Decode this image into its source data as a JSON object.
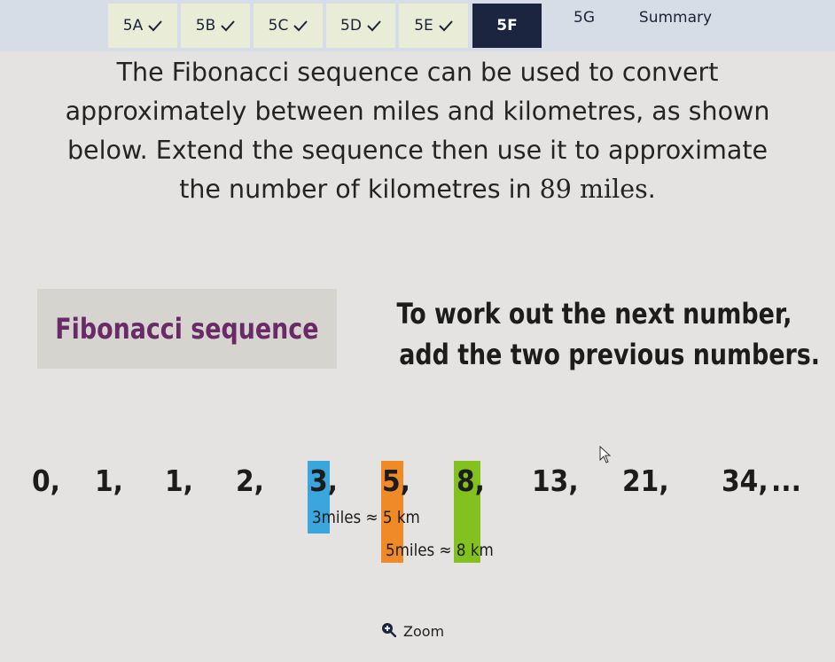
{
  "tabs": [
    {
      "label": "5A",
      "done": true
    },
    {
      "label": "5B",
      "done": true
    },
    {
      "label": "5C",
      "done": true
    },
    {
      "label": "5D",
      "done": true
    },
    {
      "label": "5E",
      "done": true
    },
    {
      "label": "5F",
      "active": true
    },
    {
      "label": "5G"
    },
    {
      "label": "Summary"
    }
  ],
  "question": {
    "line1": "The Fibonacci sequence can be used to convert",
    "line2": "approximately between miles and kilometres, as shown",
    "line3_before": "below. Extend the sequence then use it to approximate",
    "line4_before": "the number of kilometres in ",
    "line4_math": "89 miles",
    "line4_after": "."
  },
  "panel": {
    "title": "Fibonacci sequence",
    "rule_line1": "To work out the next number,",
    "rule_line2": "add the two previous numbers."
  },
  "sequence": [
    "0,",
    "1,",
    "1,",
    "2,",
    "3,",
    "5,",
    "8,",
    "13,",
    "21,",
    "34,",
    "..."
  ],
  "notes": {
    "n1_a": "3",
    "n1_b": "miles ≈ ",
    "n1_c": "5",
    "n1_d": " km",
    "n2_a": "5",
    "n2_b": "miles ≈ ",
    "n2_c": "8",
    "n2_d": " km"
  },
  "colors": {
    "blue": "#3aa6dd",
    "orange": "#f08a26",
    "green": "#83c21e",
    "title_purple": "#6a2a67",
    "active_tab": "#1b2540"
  },
  "zoom": {
    "label": "Zoom",
    "icon": "zoom-in-icon"
  }
}
